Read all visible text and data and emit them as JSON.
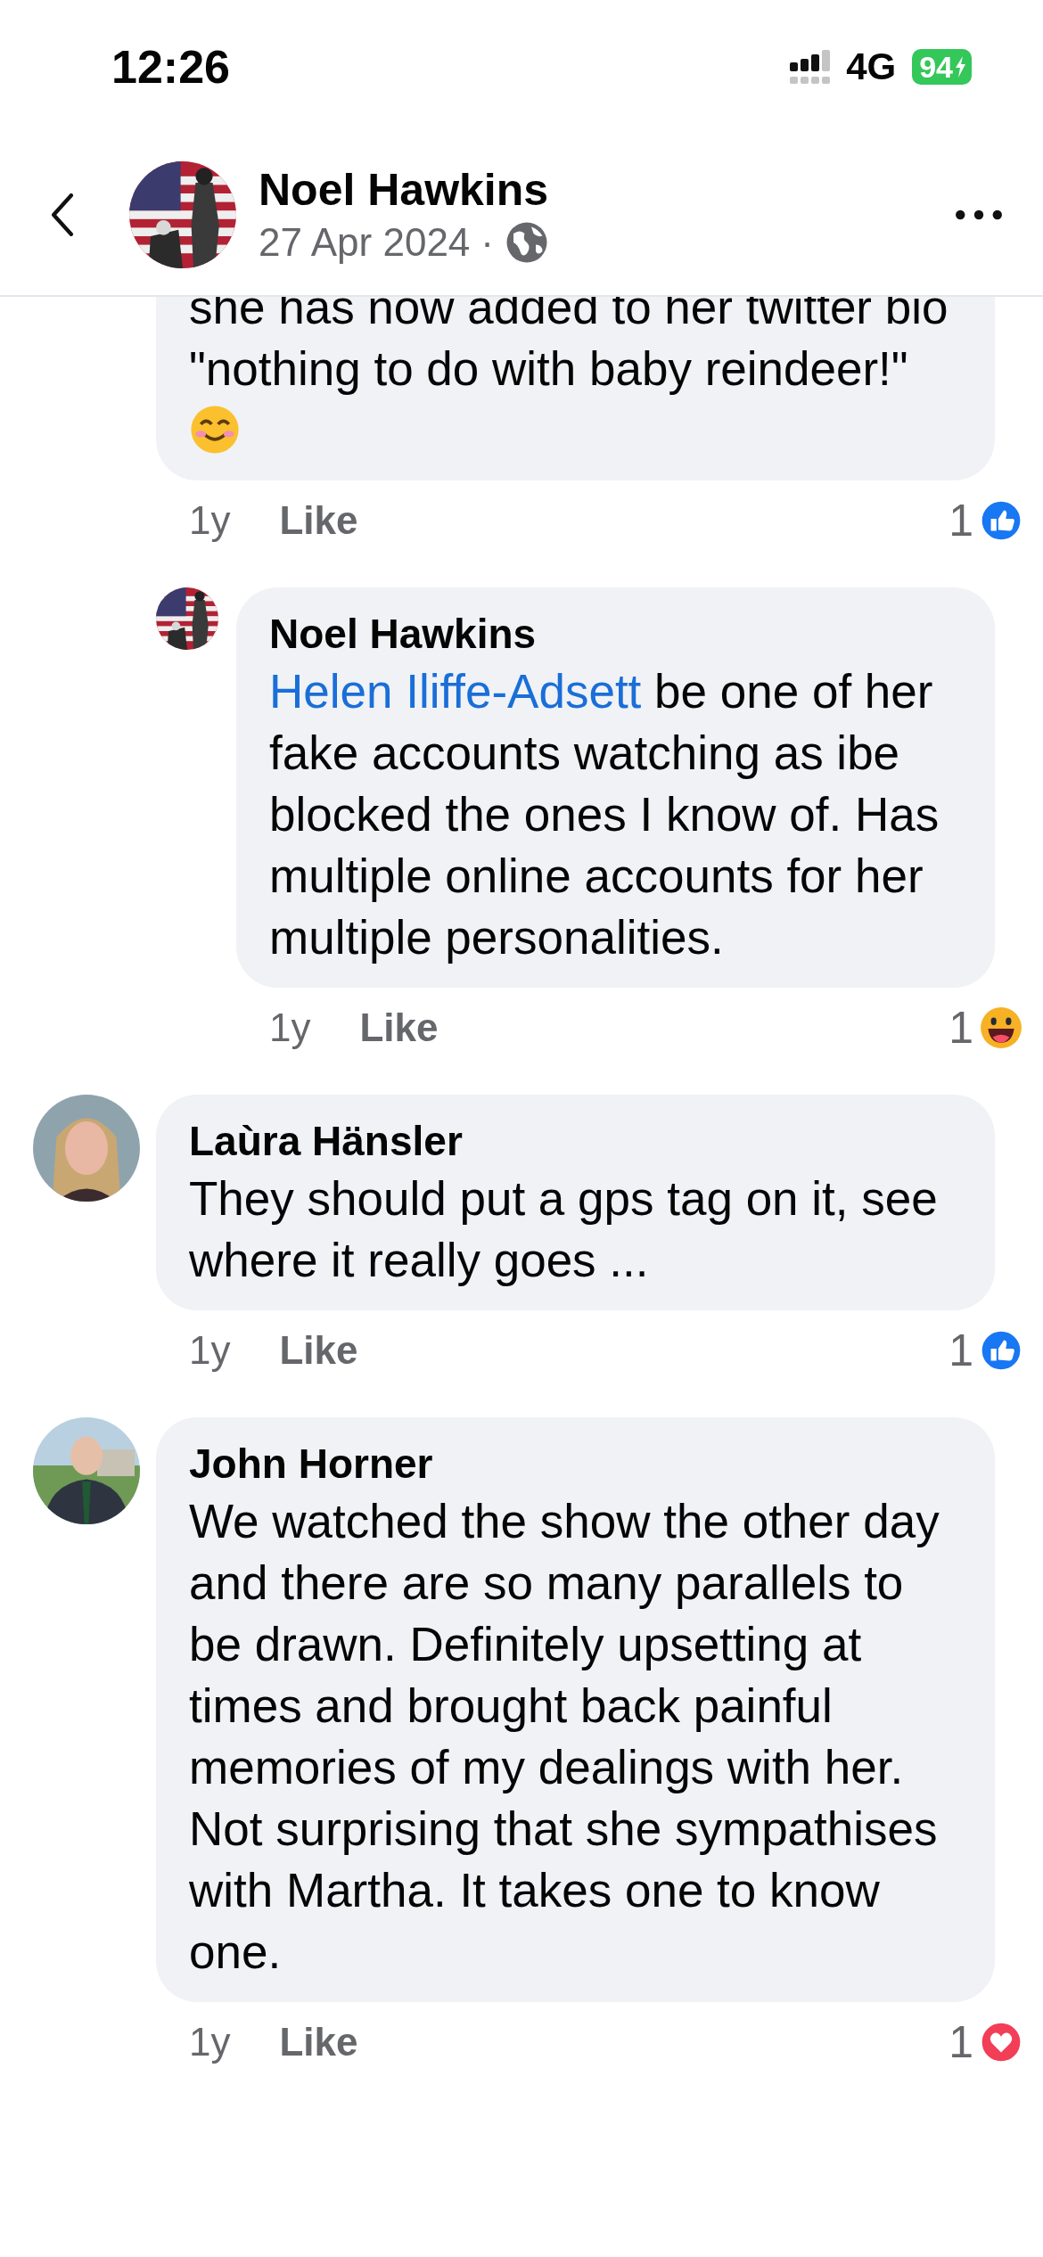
{
  "status_bar": {
    "time": "12:26",
    "network": "4G",
    "battery": "94"
  },
  "header": {
    "name": "Noel Hawkins",
    "date": "27 Apr 2024",
    "separator": "·"
  },
  "comments": [
    {
      "kind": "comment",
      "text": "she has now added to her twitter bio \"nothing to do with baby reindeer!\"",
      "trailing_emoji": true,
      "age": "1y",
      "like": "Like",
      "count": "1",
      "reaction": {
        "kind": "like"
      }
    },
    {
      "kind": "reply",
      "author": "Noel Hawkins",
      "mention": "Helen Iliffe-Adsett",
      "text": " be one of her fake accounts watching as ibe blocked the ones I know of. Has multiple online accounts for her multiple personalities.",
      "age": "1y",
      "like": "Like",
      "count": "1",
      "reaction": {
        "kind": "haha"
      }
    },
    {
      "kind": "comment",
      "author": "Laùra Hänsler",
      "text": "They should put a gps tag on it, see where it really goes ...",
      "age": "1y",
      "like": "Like",
      "count": "1",
      "reaction": {
        "kind": "like"
      }
    },
    {
      "kind": "comment",
      "author": "John Horner",
      "text": "We watched the show the other day and there are so many parallels to be drawn. Definitely upsetting at times and brought back painful memories of my dealings with her. Not surprising that she sympathises with Martha. It takes one to know one.",
      "age": "1y",
      "like": "Like",
      "count": "1",
      "reaction": {
        "kind": "love"
      }
    }
  ]
}
